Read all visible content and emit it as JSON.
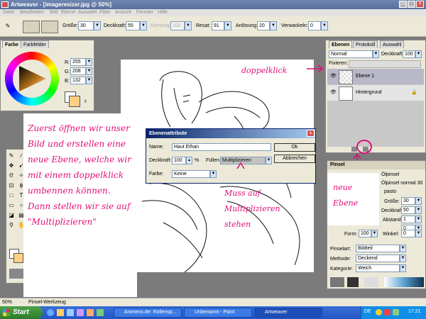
{
  "window": {
    "title": "Artweaver - [imageresizer.jpg @ 50%]"
  },
  "menu": [
    "Datei",
    "Bearbeiten",
    "Bild",
    "Ebene",
    "Auswahl",
    "Filter",
    "Ansicht",
    "Fenster",
    "Hilfe"
  ],
  "options": {
    "groesse_label": "Größe:",
    "groesse": "30",
    "deckkraft_label": "Deckkraft:",
    "deckkraft": "55",
    "koernung_label": "Körnung:",
    "koernung": "100",
    "resat_label": "Resat:",
    "resat": "91",
    "aufloesung_label": "Anlösung:",
    "aufloesung": "20",
    "verwackeln_label": "Verwackeln:",
    "verwackeln": "0"
  },
  "color_panel": {
    "tabs": [
      "Farbe",
      "Farbfelder"
    ],
    "r_label": "R:",
    "r": "255",
    "g_label": "G:",
    "g": "208",
    "b_label": "B:",
    "b": "132",
    "fg_color": "#ffd084"
  },
  "layers_panel": {
    "tabs": [
      "Ebenen",
      "Protokoll",
      "Auswahl"
    ],
    "mode": "Normal",
    "opacity_label": "Deckkraft:",
    "opacity": "100",
    "fix_label": "Fixieren:",
    "layers": [
      {
        "name": "Ebene 1"
      },
      {
        "name": "Hintergrund"
      }
    ]
  },
  "brush_panel": {
    "title": "Pinsel",
    "preset": "Ölpinsel",
    "preset_full": "Ölpinsel normal 30",
    "tab2": "pasto",
    "groesse_label": "Größe:",
    "groesse": "30",
    "deckkraft_label": "Deckkraft:",
    "deckkraft": "50",
    "abstand_label": "Abstand:",
    "abstand": "1",
    "v_label": "",
    "v": "0",
    "form_label": "Form:",
    "form": "100",
    "winkel_label": "Winkel:",
    "winkel": "0",
    "pinselart_label": "Pinselart:",
    "pinselart": "Bildteil",
    "methode_label": "Methode:",
    "methode": "Deckend",
    "kategorie_label": "Kategorie:",
    "kategorie": "Weich"
  },
  "dialog": {
    "title": "Ebenenattribute",
    "name_label": "Name:",
    "name_value": "Haut Ethan",
    "deckkraft_label": "Deckkraft:",
    "deckkraft_value": "100",
    "percent": "%",
    "fuellen_label": "Füllen:",
    "fuellen_value": "Multiplizieren",
    "farbe_label": "Farbe:",
    "farbe_value": "Keine",
    "ok": "Ok",
    "cancel": "Abbrechen"
  },
  "annotations": {
    "doppelklick": "doppelklick",
    "instructions": "Zuerst öffnen wir unser Bild und erstellen eine neue Ebene, welche wir mit einem doppelklick umbennen können. Dann stellen wir sie auf \"Multiplizieren\"",
    "muss": "Muss auf Multiplizieren stehen",
    "neue_ebene": "neue Ebene"
  },
  "status": {
    "zoom": "50%",
    "tool": "Pinsel-Werkzeug"
  },
  "taskbar": {
    "start": "Start",
    "items": [
      "Animexx.de: Rollensp...",
      "Unbenannt - Paint",
      "Artweaver"
    ],
    "lang": "DE",
    "clock": "17:21"
  },
  "colors": {
    "accent": "#e0107a",
    "xp_blue": "#2355c4"
  }
}
